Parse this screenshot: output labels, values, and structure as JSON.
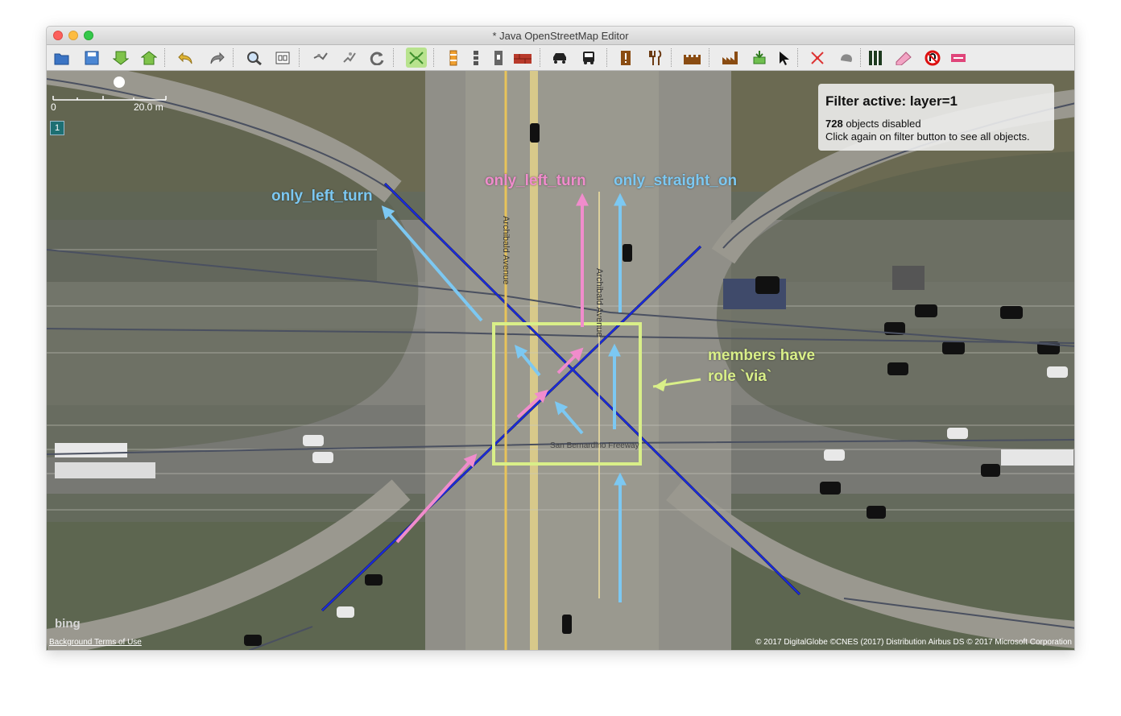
{
  "window": {
    "title": "* Java OpenStreetMap Editor"
  },
  "toolbar": {
    "buttons": [
      "open-file",
      "save",
      "download",
      "upload",
      "undo",
      "redo",
      "zoom",
      "wireframe",
      "imagery",
      "plugin",
      "refresh",
      "select-area",
      "barrier-a",
      "barrier-b",
      "gate",
      "wall",
      "car",
      "bus",
      "tower",
      "restaurant",
      "castle",
      "factory",
      "node-tool",
      "select-cursor",
      "draw",
      "preset-shape",
      "road",
      "tag-pencil",
      "no-u-turn",
      "no-entry"
    ]
  },
  "map": {
    "scale": {
      "zero": "0",
      "distance": "20.0 m"
    },
    "layer_badge": "1",
    "filter": {
      "title": "Filter active: layer=1",
      "count": "728",
      "disabled_text": "objects disabled",
      "hint": "Click again on filter button to see all objects."
    },
    "annotations": {
      "left_left": "only_left_turn",
      "top_left": "only_left_turn",
      "straight": "only_straight_on",
      "via_line1": "members have",
      "via_line2": "role `via`"
    },
    "colors": {
      "blue_label": "#7cc8f2",
      "pink_label": "#f08ccc",
      "green_label": "#d9ef88",
      "road_blue": "#1a2ad8"
    },
    "road_names": {
      "avenue": "Archibald Avenue",
      "freeway": "San Bernardino Freeway"
    },
    "bing": "bing",
    "terms": "Background Terms of Use",
    "copyright": "© 2017 DigitalGlobe ©CNES (2017) Distribution Airbus DS © 2017 Microsoft Corporation"
  }
}
